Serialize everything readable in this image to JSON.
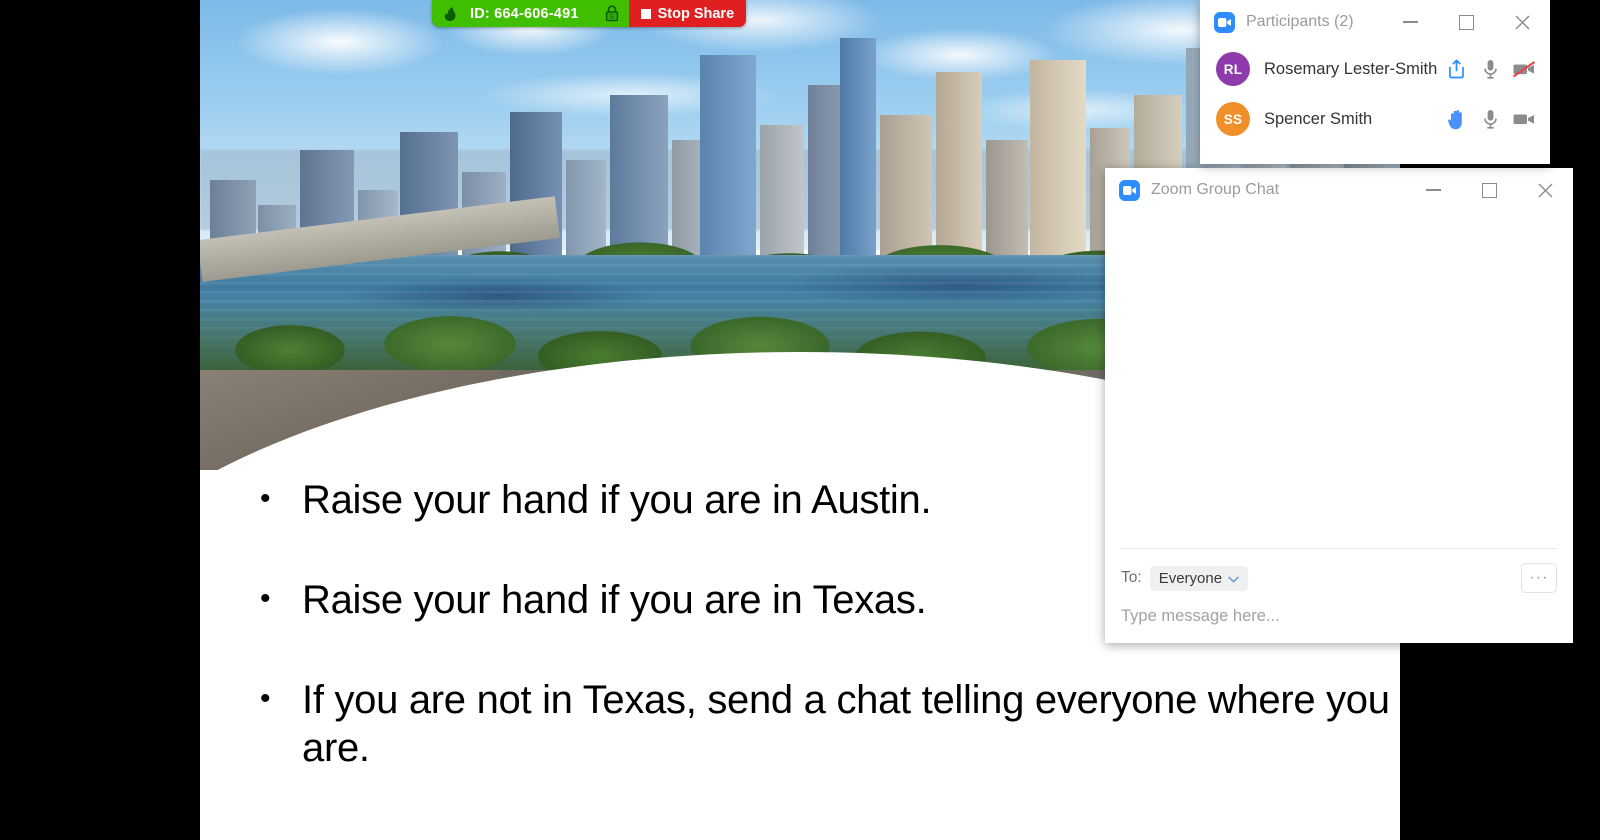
{
  "share_bar": {
    "id_label": "ID: 664-606-491",
    "stop_share_label": "Stop Share",
    "arrow_icon": "share-arrow-icon",
    "lock_icon": "encryption-lock-icon",
    "green_color": "#3fbf00",
    "red_color": "#e02020"
  },
  "slide": {
    "bullets": [
      {
        "marker": "•",
        "text": "Raise your hand if you are in Austin."
      },
      {
        "marker": "•",
        "text": "Raise your hand if you are in Texas."
      },
      {
        "marker": "•",
        "text": "If you are not in Texas, send a chat telling everyone where you are."
      }
    ]
  },
  "participants_panel": {
    "title": "Participants (2)",
    "logo_icon": "zoom-video-logo-icon",
    "minimize_label": "Minimize",
    "maximize_label": "Maximize",
    "close_label": "Close",
    "rows": [
      {
        "initials": "RL",
        "avatar_color": "#8e3aad",
        "name": "Rosemary Lester-Smith",
        "icons": [
          {
            "name": "share-screen-icon",
            "state": "active",
            "color": "#2d8cff"
          },
          {
            "name": "microphone-icon",
            "state": "on",
            "color": "#8c8c8c"
          },
          {
            "name": "video-off-icon",
            "state": "off",
            "color": "#8c8c8c"
          }
        ]
      },
      {
        "initials": "SS",
        "avatar_color": "#f0902a",
        "name": "Spencer Smith",
        "icons": [
          {
            "name": "raise-hand-icon",
            "state": "raised",
            "color": "#2d8cff"
          },
          {
            "name": "microphone-icon",
            "state": "on",
            "color": "#8c8c8c"
          },
          {
            "name": "video-on-icon",
            "state": "on",
            "color": "#8c8c8c"
          }
        ]
      }
    ]
  },
  "chat_panel": {
    "title": "Zoom Group Chat",
    "logo_icon": "zoom-video-logo-icon",
    "minimize_label": "Minimize",
    "maximize_label": "Maximize",
    "close_label": "Close",
    "messages": [],
    "to_label": "To:",
    "recipient": "Everyone",
    "recipient_caret_icon": "chevron-down-icon",
    "more_options_label": "···",
    "input_placeholder": "Type message here...",
    "input_value": ""
  },
  "theme": {
    "panel_bg": "#ffffff",
    "title_text": "#9b9b9b",
    "body_text": "#333333",
    "placeholder": "#a2a2a2",
    "zoom_blue": "#2d8cff",
    "stage_bg": "#000000"
  }
}
